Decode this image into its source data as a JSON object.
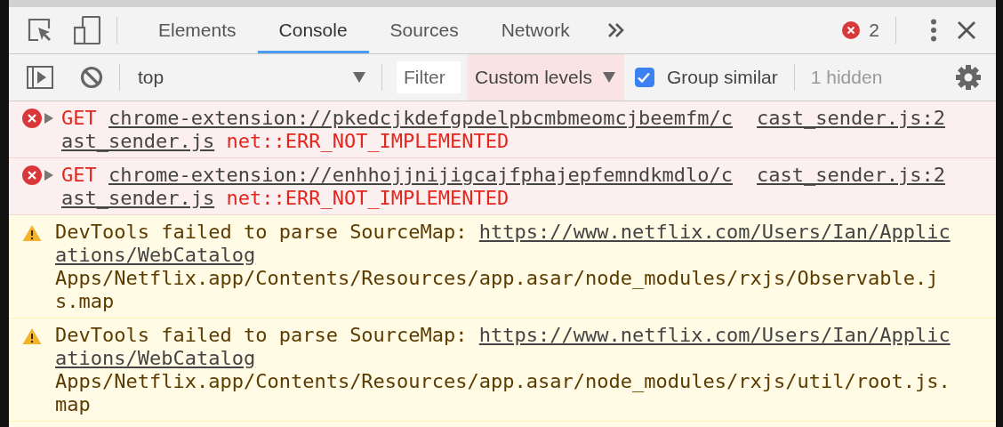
{
  "tab_bar": {
    "tabs": [
      {
        "label": "Elements",
        "selected": false
      },
      {
        "label": "Console",
        "selected": true
      },
      {
        "label": "Sources",
        "selected": false
      },
      {
        "label": "Network",
        "selected": false
      }
    ],
    "error_count": "2"
  },
  "toolbar": {
    "context": "top",
    "filter": {
      "placeholder": "Filter"
    },
    "levels": "Custom levels",
    "group_similar": {
      "label": "Group similar",
      "checked": true
    },
    "hidden_count": "1 hidden"
  },
  "messages": [
    {
      "kind": "error",
      "expanded": false,
      "method": "GET",
      "url": "chrome-extension://pkedcjkdefgpdelpbcmbmeomcjbeemfm/cast_sender.js",
      "text": "net::ERR_NOT_IMPLEMENTED",
      "source": "cast_sender.js:2"
    },
    {
      "kind": "error",
      "expanded": false,
      "method": "GET",
      "url": "chrome-extension://enhhojjnijigcajfphajepfemndkmdlo/cast_sender.js",
      "text": "net::ERR_NOT_IMPLEMENTED",
      "source": "cast_sender.js:2"
    },
    {
      "kind": "warning",
      "text": "DevTools failed to parse SourceMap: ",
      "url": "https://www.netflix.com/Users/Ian/Applications/WebCatalog",
      "detail": "Apps/Netflix.app/Contents/Resources/app.asar/node_modules/rxjs/Observable.js.map"
    },
    {
      "kind": "warning",
      "text": "DevTools failed to parse SourceMap: ",
      "url": "https://www.netflix.com/Users/Ian/Applications/WebCatalog",
      "detail": "Apps/Netflix.app/Contents/Resources/app.asar/node_modules/rxjs/util/root.js.map"
    }
  ]
}
